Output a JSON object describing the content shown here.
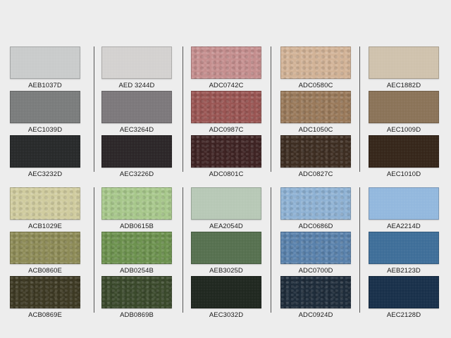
{
  "swatches": [
    {
      "code": "AEB1037D",
      "color": "#c9cbcb",
      "texture": "smooth"
    },
    {
      "code": "AED 3244D",
      "color": "#d3d1d0",
      "texture": "smooth"
    },
    {
      "code": "ADC0742C",
      "color": "#c58f8f",
      "texture": "rough"
    },
    {
      "code": "ADC0580C",
      "color": "#d2b397",
      "texture": "rough"
    },
    {
      "code": "AEC1882D",
      "color": "#cfc2ad",
      "texture": "smooth"
    },
    {
      "code": "AEC1039D",
      "color": "#7a7c7c",
      "texture": "smooth"
    },
    {
      "code": "AEC3264D",
      "color": "#7c787b",
      "texture": "smooth"
    },
    {
      "code": "ADC0987C",
      "color": "#9a5654",
      "texture": "rough"
    },
    {
      "code": "ADC1050C",
      "color": "#9a7a5b",
      "texture": "rough"
    },
    {
      "code": "AEC1009D",
      "color": "#8a7358",
      "texture": "smooth"
    },
    {
      "code": "AEC3232D",
      "color": "#27292a",
      "texture": "smooth"
    },
    {
      "code": "AEC3226D",
      "color": "#2b2628",
      "texture": "smooth"
    },
    {
      "code": "ADC0801C",
      "color": "#3f2424",
      "texture": "rough"
    },
    {
      "code": "ADC0827C",
      "color": "#3e2e22",
      "texture": "rough"
    },
    {
      "code": "AEC1010D",
      "color": "#35261a",
      "texture": "smooth"
    },
    {
      "code": "ACB1029E",
      "color": "#d0cc9f",
      "texture": "rough"
    },
    {
      "code": "ADB0615B",
      "color": "#a8c88c",
      "texture": "rough"
    },
    {
      "code": "AEA2054D",
      "color": "#b7c8b6",
      "texture": "smooth"
    },
    {
      "code": "ADC0686D",
      "color": "#8fb2d4",
      "texture": "rough"
    },
    {
      "code": "AEA2214D",
      "color": "#93b8de",
      "texture": "smooth"
    },
    {
      "code": "ACB0860E",
      "color": "#8e8c58",
      "texture": "rough"
    },
    {
      "code": "ADB0254B",
      "color": "#6d924f",
      "texture": "rough"
    },
    {
      "code": "AEB3025D",
      "color": "#56704f",
      "texture": "smooth"
    },
    {
      "code": "ADC0700D",
      "color": "#5a82ac",
      "texture": "rough"
    },
    {
      "code": "AEB2123D",
      "color": "#3e6e99",
      "texture": "smooth"
    },
    {
      "code": "ACB0869E",
      "color": "#3e3a24",
      "texture": "rough"
    },
    {
      "code": "ADB0869B",
      "color": "#3b4a2c",
      "texture": "rough"
    },
    {
      "code": "AEC3032D",
      "color": "#1f271f",
      "texture": "smooth"
    },
    {
      "code": "ADC0924D",
      "color": "#1f2d3b",
      "texture": "rough"
    },
    {
      "code": "AEC2128D",
      "color": "#18304a",
      "texture": "smooth"
    }
  ]
}
